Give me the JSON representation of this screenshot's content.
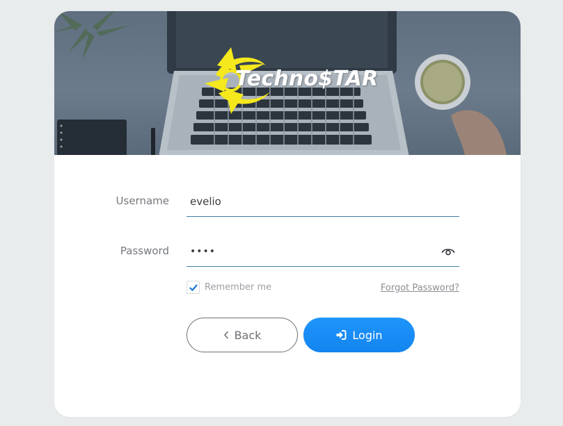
{
  "banner": {
    "logo_text": "Techno$TAR",
    "brand_colors": {
      "logo_yellow": "#f5e81c",
      "overlay": "#627282"
    }
  },
  "form": {
    "username": {
      "label": "Username",
      "value": "evelio"
    },
    "password": {
      "label": "Password",
      "value": "••••",
      "toggle_icon": "eye-icon"
    },
    "remember": {
      "label": "Remember me",
      "checked": true
    },
    "forgot_label": "Forgot Password?"
  },
  "buttons": {
    "back_label": "Back",
    "back_icon": "chevron-left-icon",
    "login_label": "Login",
    "login_icon": "sign-in-icon"
  },
  "colors": {
    "accent": "#1a8ff7",
    "underline": "#3d7fa8",
    "page_bg": "#e9eced"
  }
}
